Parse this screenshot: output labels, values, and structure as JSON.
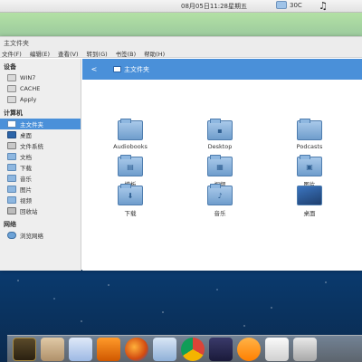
{
  "top_panel": {
    "clock": "08月05日11:28星期五",
    "temperature": "30C"
  },
  "window": {
    "title": "主文件夹",
    "menu": [
      "文件(F)",
      "编辑(E)",
      "查看(V)",
      "转到(G)",
      "书签(B)",
      "帮助(H)"
    ]
  },
  "sidebar": {
    "devices_header": "设备",
    "devices": [
      "WIN7",
      "CACHE",
      "Apply"
    ],
    "computer_header": "计算机",
    "computer": [
      "主文件夹",
      "桌面",
      "文件系统",
      "文档",
      "下载",
      "音乐",
      "图片",
      "视频",
      "回收站"
    ],
    "network_header": "网络",
    "network": [
      "浏览网络"
    ]
  },
  "pathbar": {
    "back": "<",
    "crumb": "主文件夹"
  },
  "files": [
    "Audiobooks",
    "Desktop",
    "Podcasts",
    "模板",
    "视频",
    "图片",
    "下载",
    "音乐",
    "桌面"
  ],
  "dock": {
    "apps": [
      "system-monitor-icon",
      "file-manager-icon",
      "baidu-icon",
      "vlc-icon",
      "firefox-icon",
      "network-icon",
      "chrome-icon",
      "qq-icon",
      "chat-icon",
      "document-icon",
      "storage-icon"
    ]
  },
  "colors": {
    "accent": "#4a90d9"
  }
}
